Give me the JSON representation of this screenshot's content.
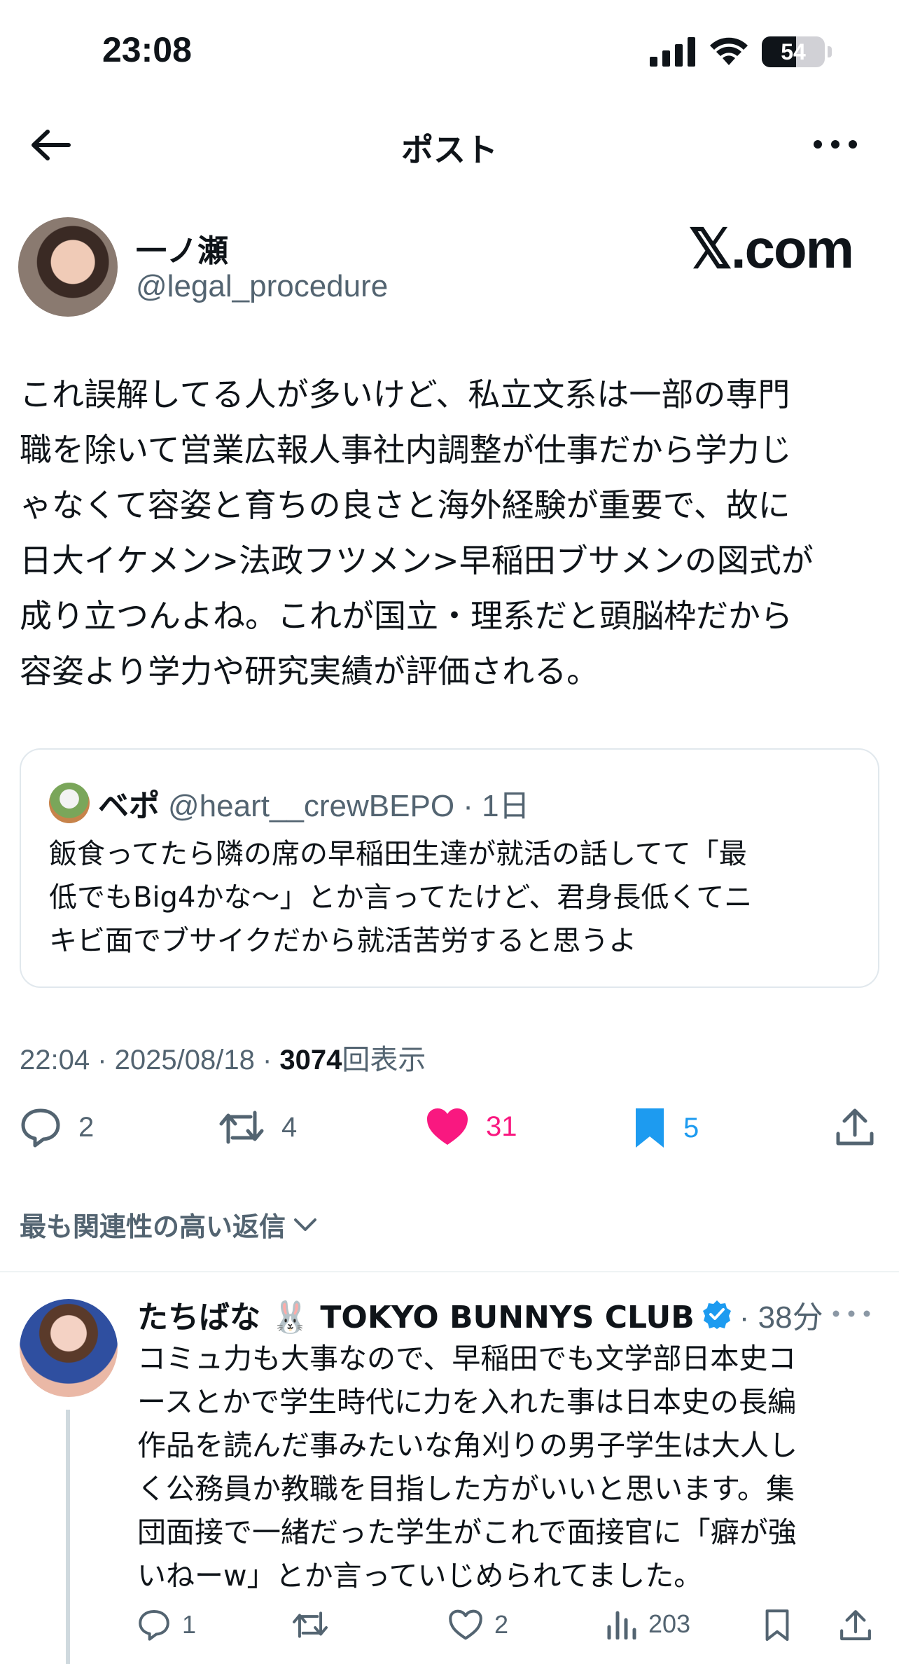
{
  "status_bar": {
    "time": "23:08",
    "battery": "54",
    "battery_level": 0.54
  },
  "nav": {
    "title": "ポスト"
  },
  "post": {
    "author_name": "一ノ瀬",
    "author_handle": "@legal_procedure",
    "watermark": "𝕏.com",
    "body": "これ誤解してる人が多いけど、私立文系は一部の専門\n職を除いて営業広報人事社内調整が仕事だから学力じ\nゃなくて容姿と育ちの良さと海外経験が重要で、故に\n日大イケメン>法政フツメン>早稲田ブサメンの図式が\n成り立つんよね。これが国立・理系だと頭脳枠だから\n容姿より学力や研究実績が評価される。",
    "time_date": "22:04 · 2025/08/18 · ",
    "views": "3074",
    "views_label": "回表示",
    "counts": {
      "replies": "2",
      "reposts": "4",
      "likes": "31",
      "bookmarks": "5"
    }
  },
  "quote": {
    "name": "ベポ",
    "handle_time": "@heart__crewBEPO · 1日",
    "body": "飯食ってたら隣の席の早稲田生達が就活の話してて「最\n低でもBig4かな〜」とか言ってたけど、君身長低くてニ\nキビ面でブサイクだから就活苦労すると思うよ"
  },
  "sort_label": "最も関連性の高い返信",
  "reply": {
    "name": "たちばな 🐰 TOKYO BUNNYS CLUB",
    "time": "· 38分",
    "body": "コミュ力も大事なので、早稲田でも文学部日本史コ\nースとかで学生時代に力を入れた事は日本史の長編\n作品を読んだ事みたいな角刈りの男子学生は大人し\nく公務員か教職を目指した方がいいと思います。集\n団面接で一緒だった学生がこれで面接官に「癖が強\nいねーw」とか言っていじめられてました。",
    "counts": {
      "replies": "1",
      "reposts": "",
      "likes": "2",
      "views": "203"
    }
  },
  "colors": {
    "like": "#f91880",
    "bookmark": "#1d9bf0",
    "muted": "#536471",
    "verified": "#1d9bf0"
  }
}
